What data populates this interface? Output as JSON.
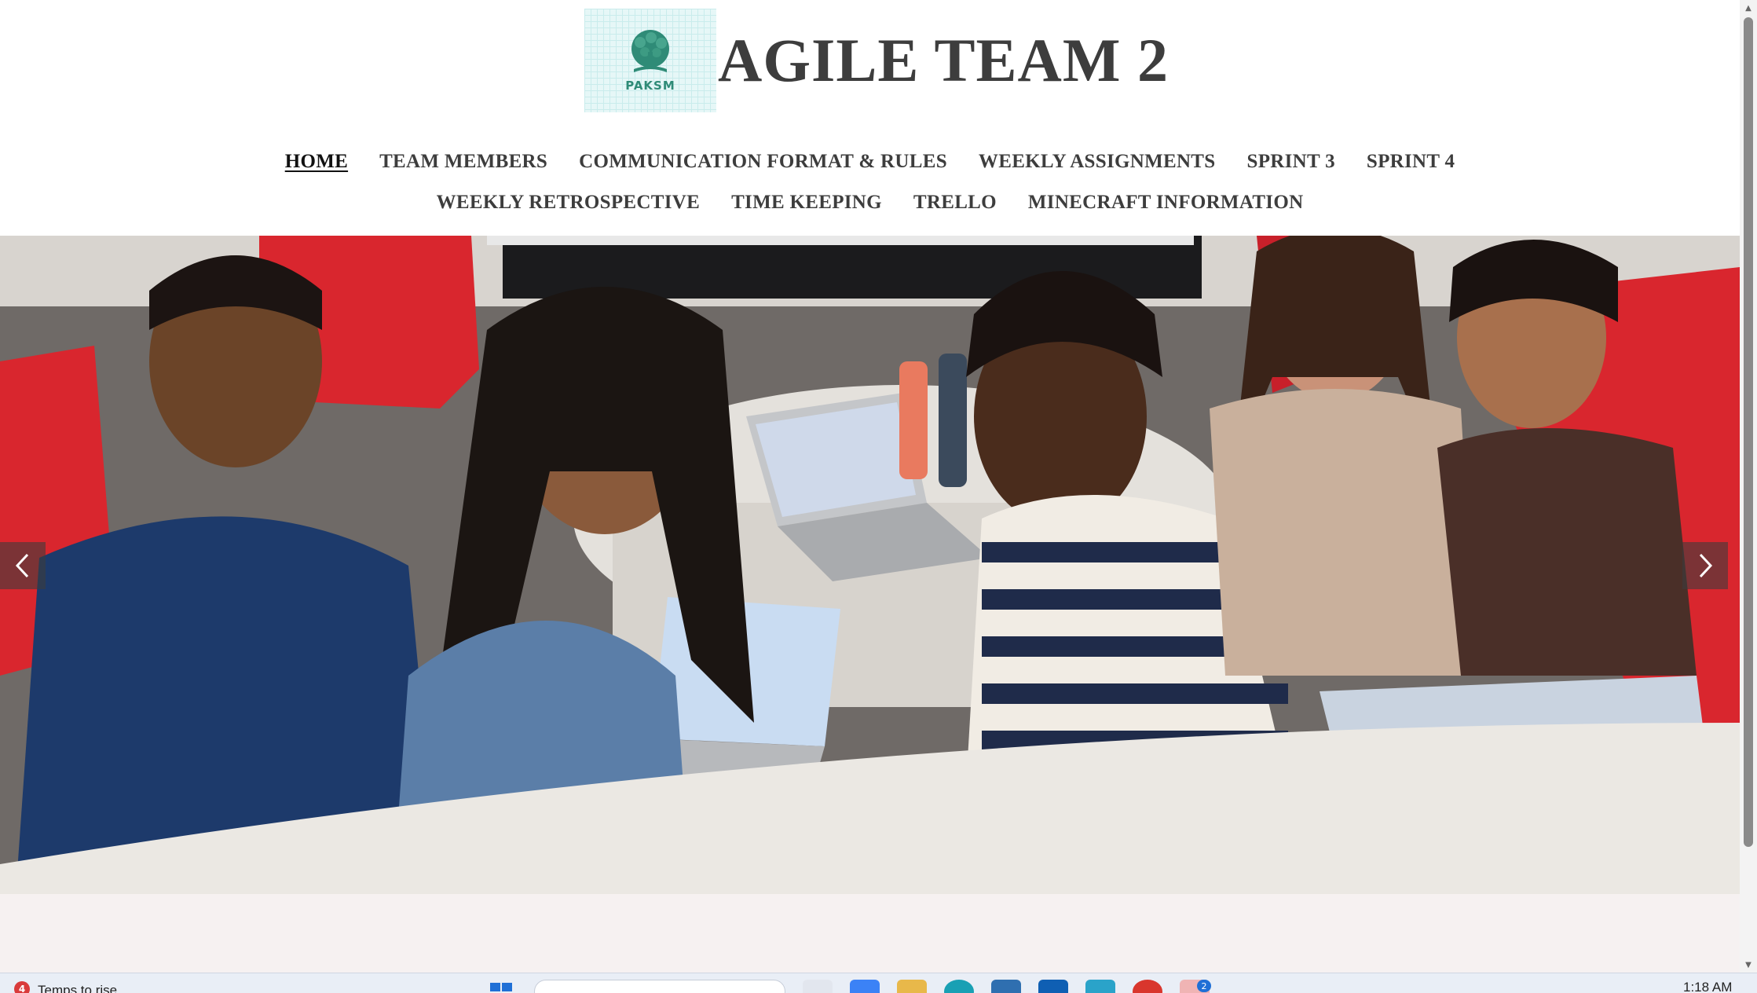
{
  "site": {
    "title": "AGILE TEAM 2",
    "logo_text": "PAKSM"
  },
  "nav": {
    "row1": [
      {
        "label": "HOME",
        "active": true
      },
      {
        "label": "TEAM MEMBERS"
      },
      {
        "label": "COMMUNICATION FORMAT & RULES"
      },
      {
        "label": "WEEKLY ASSIGNMENTS"
      },
      {
        "label": "SPRINT 3"
      },
      {
        "label": "SPRINT 4"
      }
    ],
    "row2": [
      {
        "label": "WEEKLY RETROSPECTIVE"
      },
      {
        "label": "TIME KEEPING"
      },
      {
        "label": "TRELLO"
      },
      {
        "label": "MINECRAFT INFORMATION"
      }
    ]
  },
  "slideshow": {
    "prev_icon": "chevron-left-icon",
    "next_icon": "chevron-right-icon"
  },
  "taskbar": {
    "weather_badge": "4",
    "weather_text": "Temps to rise",
    "app_badge": "2",
    "clock": "1:18 AM"
  },
  "colors": {
    "title": "#3d3d3d",
    "logo_bg": "#e6f7f7",
    "logo_green": "#2f8b77",
    "chair_red": "#d9262e",
    "below_bg": "#f6f1f1"
  }
}
